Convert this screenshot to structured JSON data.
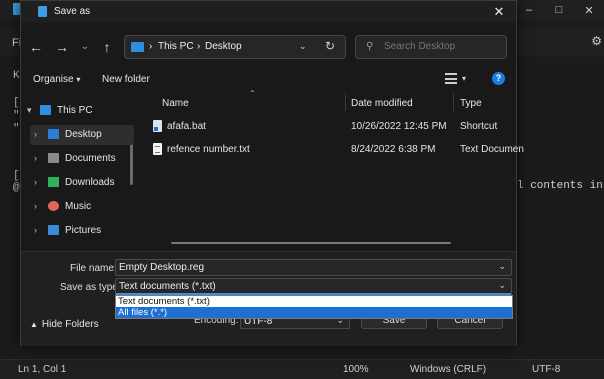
{
  "background_app": {
    "menu_fragment": "Fi",
    "editor_lines": [
      "K",
      "[",
      "\"",
      "\"",
      "[",
      "@"
    ],
    "editor_tail": "l contents in c",
    "status": {
      "position": "Ln 1, Col 1",
      "zoom": "100%",
      "line_endings": "Windows (CRLF)",
      "encoding": "UTF-8"
    }
  },
  "dialog": {
    "title": "Save as",
    "address": {
      "segments": [
        "This PC",
        "Desktop"
      ]
    },
    "search_placeholder": "Search Desktop",
    "toolbar": {
      "organise": "Organise",
      "new_folder": "New folder"
    },
    "nav_tree": [
      {
        "label": "This PC",
        "icon": "pc-icon",
        "color": "#2e8ee0",
        "expanded": true,
        "indent": 0
      },
      {
        "label": "Desktop",
        "icon": "desktop-folder-icon",
        "color": "#2a7fd4",
        "selected": true,
        "indent": 1
      },
      {
        "label": "Documents",
        "icon": "documents-folder-icon",
        "color": "#8a8a8a",
        "indent": 1
      },
      {
        "label": "Downloads",
        "icon": "download-icon",
        "color": "#2fb35a",
        "indent": 1
      },
      {
        "label": "Music",
        "icon": "music-icon",
        "color": "#e06a5a",
        "indent": 1
      },
      {
        "label": "Pictures",
        "icon": "pictures-icon",
        "color": "#3a8ad8",
        "indent": 1
      }
    ],
    "columns": [
      "Name",
      "Date modified",
      "Type"
    ],
    "files": [
      {
        "name": "afafa.bat",
        "date": "10/26/2022 12:45 PM",
        "type": "Shortcut",
        "icon": "bat-file-icon"
      },
      {
        "name": "refence number.txt",
        "date": "8/24/2022 6:38 PM",
        "type": "Text Documen",
        "icon": "txt-file-icon"
      }
    ],
    "form": {
      "file_name_label": "File name:",
      "file_name_value": "Empty Desktop.reg",
      "save_as_type_label": "Save as type:",
      "save_as_type_value": "Text documents (*.txt)",
      "type_options": [
        "Text documents (*.txt)",
        "All files  (*.*)"
      ],
      "selected_option": "All files  (*.*)",
      "encoding_label": "Encoding:",
      "encoding_value": "UTF-8",
      "save_button": "Save",
      "cancel_button": "Cancel",
      "hide_folders": "Hide Folders"
    }
  },
  "colors": {
    "accent": "#1e6fd0",
    "help": "#1a7ee0"
  }
}
